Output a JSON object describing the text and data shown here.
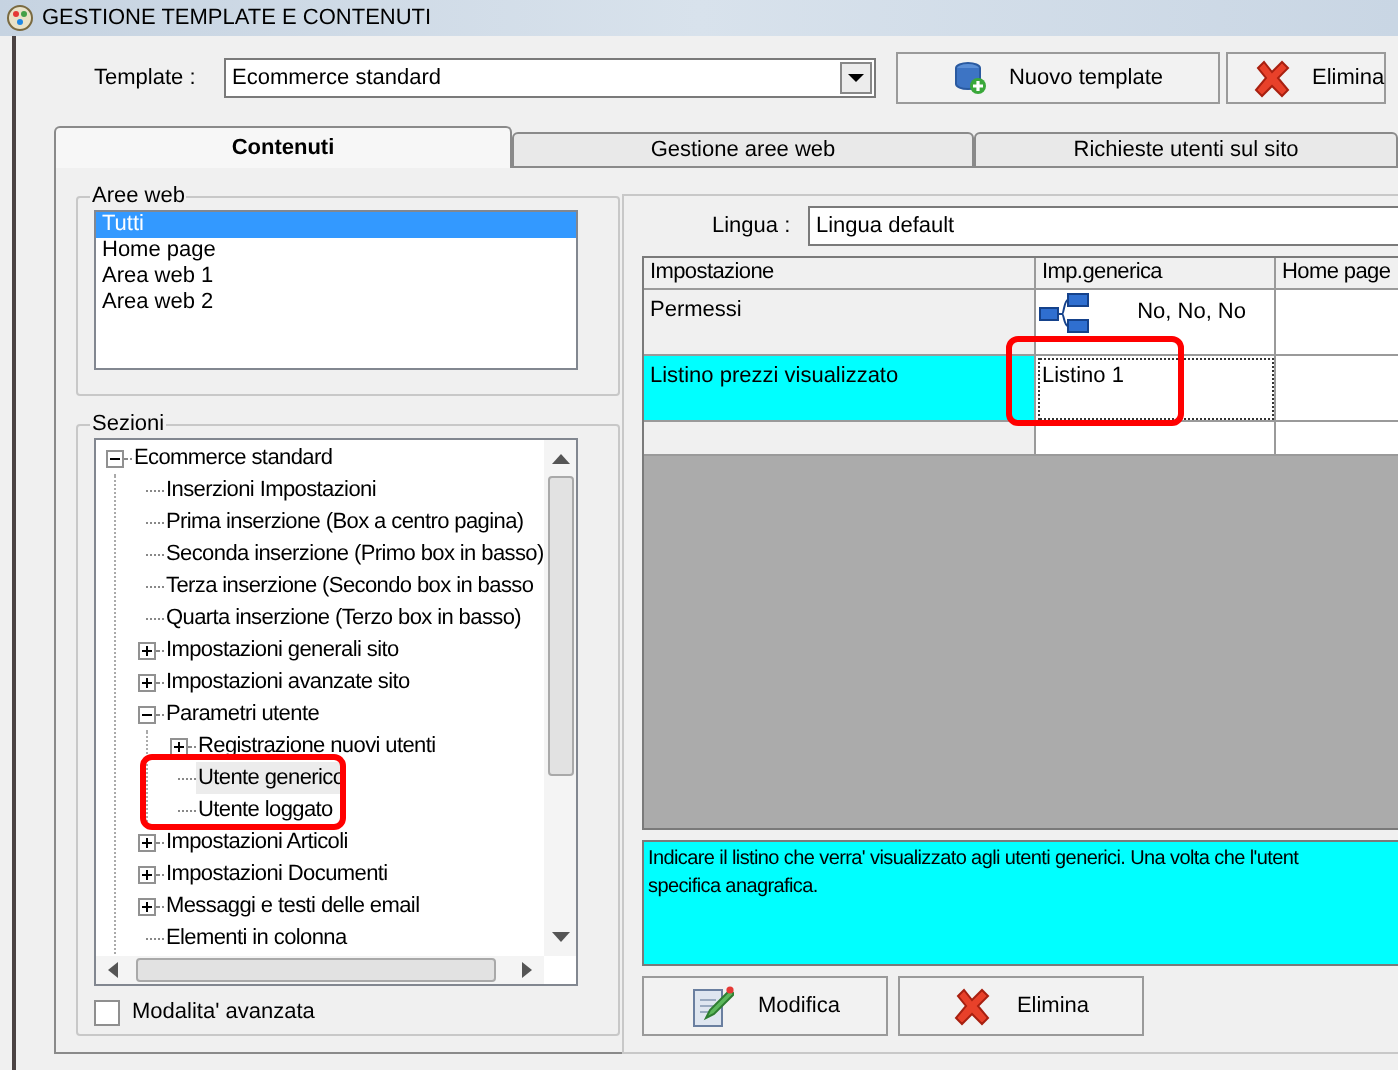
{
  "window": {
    "title": "GESTIONE TEMPLATE E CONTENUTI"
  },
  "template": {
    "label": "Template :",
    "value": "Ecommerce standard"
  },
  "toolbar_buttons": [
    {
      "label": "Nuovo template",
      "kind": "new"
    },
    {
      "label": "Elimina",
      "kind": "delete"
    }
  ],
  "tabs": [
    {
      "label": "Contenuti",
      "selected": true
    },
    {
      "label": "Gestione aree web",
      "selected": false
    },
    {
      "label": "Richieste utenti sul sito",
      "selected": false
    }
  ],
  "aree_web": {
    "title": "Aree web",
    "items": [
      {
        "label": "Tutti",
        "selected": true
      },
      {
        "label": "Home page",
        "selected": false
      },
      {
        "label": "Area web 1",
        "selected": false
      },
      {
        "label": "Area web 2",
        "selected": false
      }
    ]
  },
  "sezioni": {
    "title": "Sezioni",
    "tree": [
      {
        "label": "Ecommerce standard",
        "kind": "group",
        "expanded": true,
        "selected": false,
        "children": [
          {
            "label": "Inserzioni Impostazioni",
            "kind": "leaf",
            "selected": false
          },
          {
            "label": "Prima inserzione (Box a centro pagina)",
            "kind": "leaf",
            "selected": false
          },
          {
            "label": "Seconda inserzione (Primo box in basso)",
            "kind": "leaf",
            "selected": false
          },
          {
            "label": "Terza inserzione (Secondo box in basso",
            "kind": "leaf",
            "selected": false
          },
          {
            "label": "Quarta inserzione (Terzo box in basso)",
            "kind": "leaf",
            "selected": false
          },
          {
            "label": "Impostazioni generali sito",
            "kind": "group",
            "expanded": false,
            "selected": false
          },
          {
            "label": "Impostazioni avanzate sito",
            "kind": "group",
            "expanded": false,
            "selected": false
          },
          {
            "label": "Parametri utente",
            "kind": "group",
            "expanded": true,
            "selected": false,
            "children": [
              {
                "label": "Registrazione nuovi utenti",
                "kind": "group",
                "expanded": false,
                "selected": false
              },
              {
                "label": "Utente generico",
                "kind": "leaf",
                "selected": true
              },
              {
                "label": "Utente loggato",
                "kind": "leaf",
                "selected": false
              }
            ]
          },
          {
            "label": "Impostazioni Articoli",
            "kind": "group",
            "expanded": false,
            "selected": false
          },
          {
            "label": "Impostazioni Documenti",
            "kind": "group",
            "expanded": false,
            "selected": false
          },
          {
            "label": "Messaggi e testi delle email",
            "kind": "group",
            "expanded": false,
            "selected": false
          },
          {
            "label": "Elementi in colonna",
            "kind": "leaf",
            "selected": false
          }
        ]
      }
    ]
  },
  "advanced_mode": {
    "label": "Modalita' avanzata",
    "checked": false
  },
  "lingua": {
    "label": "Lingua :",
    "value": "Lingua default"
  },
  "grid": {
    "columns": [
      "Impostazione",
      "Imp.generica",
      "Home page"
    ],
    "rows": [
      {
        "kind": "permissions",
        "setting": "Permessi",
        "value": "No, No, No",
        "selected": false
      },
      {
        "kind": "text",
        "setting": "Listino prezzi visualizzato",
        "value": "Listino 1",
        "selected": true
      }
    ]
  },
  "description": {
    "lines": [
      "Indicare il listino che verra' visualizzato agli utenti generici. Una volta che l'utent",
      "specifica anagrafica."
    ]
  },
  "buttons": [
    {
      "label": "Modifica",
      "kind": "edit"
    },
    {
      "label": "Elimina",
      "kind": "delete"
    }
  ]
}
